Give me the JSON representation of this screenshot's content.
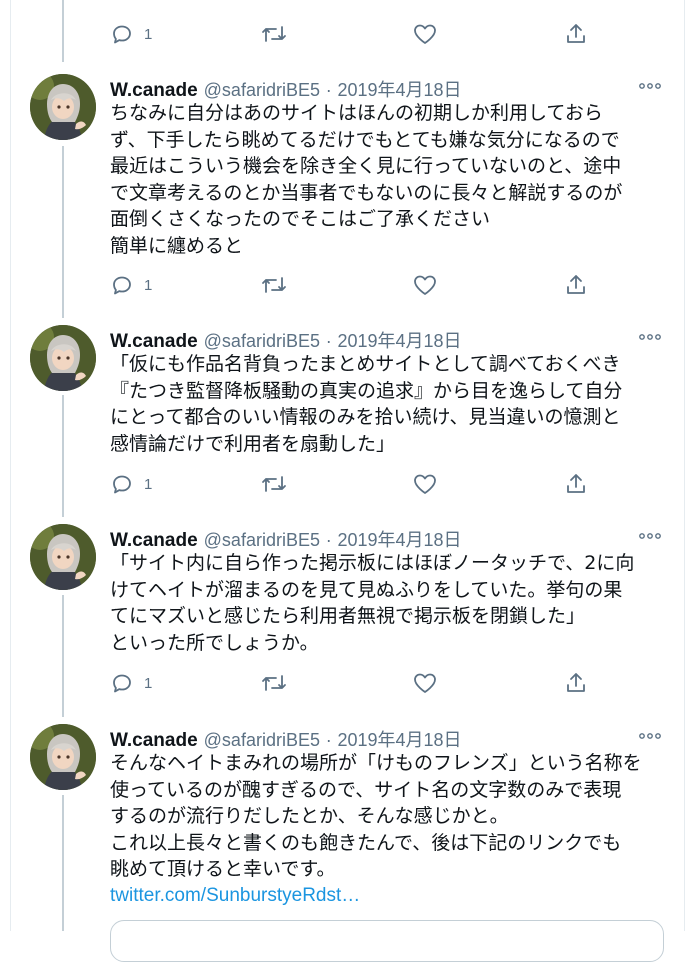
{
  "top_partial": {
    "text": "ー　　　　　　　　　　　　　",
    "reply_count": "1"
  },
  "tweets": [
    {
      "name": "W.canade",
      "handle": "@safaridriBE5",
      "sep": "·",
      "date": "2019年4月18日",
      "text": "ちなみに自分はあのサイトはほんの初期しか利用しておら\nず、下手したら眺めてるだけでもとても嫌な気分になるので\n最近はこういう機会を除き全く見に行っていないのと、途中\nで文章考えるのとか当事者でもないのに長々と解説するのが\n面倒くさくなったのでそこはご了承ください\n簡単に纏めると",
      "reply_count": "1"
    },
    {
      "name": "W.canade",
      "handle": "@safaridriBE5",
      "sep": "·",
      "date": "2019年4月18日",
      "text": "「仮にも作品名背負ったまとめサイトとして調べておくべき\n『たつき監督降板騒動の真実の追求』から目を逸らして自分\nにとって都合のいい情報のみを拾い続け、見当違いの憶測と\n感情論だけで利用者を扇動した」",
      "reply_count": "1"
    },
    {
      "name": "W.canade",
      "handle": "@safaridriBE5",
      "sep": "·",
      "date": "2019年4月18日",
      "text": "「サイト内に自ら作った掲示板にはほぼノータッチで、2に向\nけてヘイトが溜まるのを見て見ぬふりをしていた。挙句の果\nてにマズいと感じたら利用者無視で掲示板を閉鎖した」\nといった所でしょうか。",
      "reply_count": "1"
    },
    {
      "name": "W.canade",
      "handle": "@safaridriBE5",
      "sep": "·",
      "date": "2019年4月18日",
      "text": "そんなヘイトまみれの場所が「けものフレンズ」という名称を\n使っているのが醜すぎるので、サイト名の文字数のみで表現\nするのが流行りだしたとか、そんな感じかと。\nこれ以上長々と書くのも飽きたんで、後は下記のリンクでも\n眺めて頂けると幸いです。",
      "link": "twitter.com/SunburstyeRdst…"
    }
  ],
  "icons": {
    "reply": "reply-icon",
    "retweet": "retweet-icon",
    "like": "heart-icon",
    "share": "share-icon",
    "more": "more-icon"
  },
  "colors": {
    "text": "#0f1419",
    "muted": "#5b7083",
    "link": "#1b95e0",
    "thread_line": "#c4cfd6"
  }
}
